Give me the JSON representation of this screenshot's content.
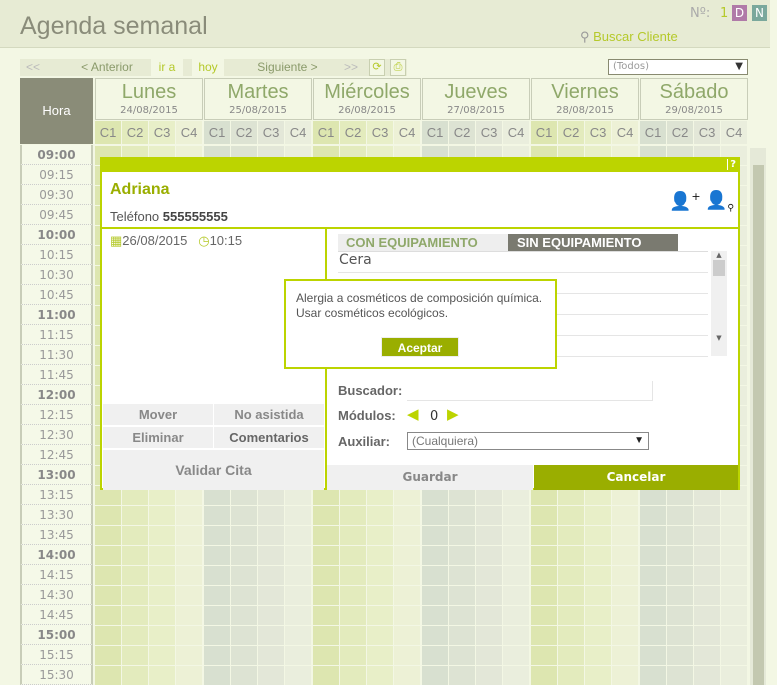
{
  "header": {
    "title": "Agenda semanal",
    "number_label": "Nº:",
    "number_value": "1",
    "badges": [
      {
        "label": "D",
        "color": "#b07aa8"
      },
      {
        "label": "N",
        "color": "#7aa89c"
      }
    ],
    "search_client": "Buscar Cliente"
  },
  "toolbar": {
    "first": "<<",
    "prev": "< Anterior",
    "goto": "ir a",
    "today": "hoy",
    "next": "Siguiente >",
    "last": ">>",
    "refresh_icon": "refresh-icon",
    "print_icon": "print-icon",
    "filter": "(Todos)"
  },
  "grid": {
    "hora_label": "Hora",
    "days": [
      {
        "name": "Lunes",
        "date": "24/08/2015"
      },
      {
        "name": "Martes",
        "date": "25/08/2015"
      },
      {
        "name": "Miércoles",
        "date": "26/08/2015"
      },
      {
        "name": "Jueves",
        "date": "27/08/2015"
      },
      {
        "name": "Viernes",
        "date": "28/08/2015"
      },
      {
        "name": "Sábado",
        "date": "29/08/2015"
      }
    ],
    "cabins": [
      "C1",
      "C2",
      "C3",
      "C4"
    ],
    "times": [
      "09:00",
      "09:15",
      "09:30",
      "09:45",
      "10:00",
      "10:15",
      "10:30",
      "10:45",
      "11:00",
      "11:15",
      "11:30",
      "11:45",
      "12:00",
      "12:15",
      "12:30",
      "12:45",
      "13:00",
      "13:15",
      "13:30",
      "13:45",
      "14:00",
      "14:15",
      "14:30",
      "14:45",
      "15:00",
      "15:15",
      "15:30"
    ],
    "colors": {
      "green": [
        "#dde6b0",
        "#e3ebbd",
        "#e8efc8",
        "#edf1d6"
      ],
      "gray": [
        "#d8e0d0",
        "#dde3d3",
        "#e3e7d8",
        "#eaeedd"
      ]
    }
  },
  "modal": {
    "help": "?",
    "client_name": "Adriana",
    "phone_label": "Teléfono",
    "phone": "555555555",
    "date": "26/08/2015",
    "time": "10:15",
    "actions": {
      "move": "Mover",
      "no_show": "No asistida",
      "delete": "Eliminar",
      "comments": "Comentarios",
      "validate": "Validar Cita"
    },
    "tabs": {
      "with_equipment": "CON EQUIPAMIENTO",
      "without_equipment": "SIN EQUIPAMIENTO"
    },
    "services": [
      "Cera"
    ],
    "search_label": "Buscador:",
    "search_value": "",
    "modules_label": "Módulos:",
    "modules_value": "0",
    "aux_label": "Auxiliar:",
    "aux_value": "(Cualquiera)",
    "save": "Guardar",
    "cancel": "Cancelar"
  },
  "alert": {
    "message": "Alergia a cosméticos de composición química. Usar cosméticos ecológicos.",
    "accept": "Aceptar"
  }
}
